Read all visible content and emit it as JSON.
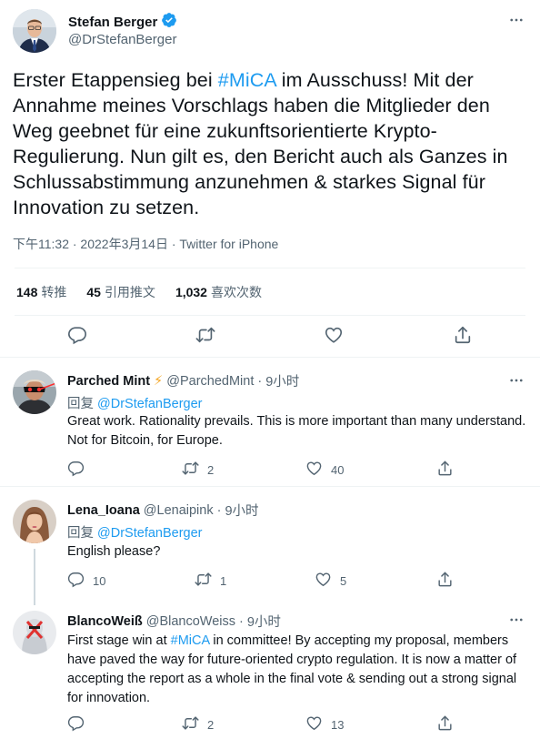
{
  "main_tweet": {
    "author_name": "Stefan Berger",
    "author_handle": "@DrStefanBerger",
    "text_before": "Erster Etappensieg bei ",
    "hashtag": "#MiCA",
    "text_after": " im Ausschuss! Mit der Annahme meines Vorschlags haben die Mitglieder den Weg geebnet für eine zukunftsorientierte Krypto-Regulierung. Nun gilt es, den Bericht auch als Ganzes in Schlussabstimmung anzunehmen & starkes Signal für Innovation zu setzen.",
    "timestamp": "下午11:32 · 2022年3月14日 · Twitter for iPhone",
    "retweets": "148",
    "retweets_label": "转推",
    "quotes": "45",
    "quotes_label": "引用推文",
    "likes": "1,032",
    "likes_label": "喜欢次数",
    "verified_color": "#1d9bf0"
  },
  "replies": [
    {
      "name": "Parched Mint",
      "badge": "⚡",
      "handle": "@ParchedMint",
      "time": "9小时",
      "reply_prefix": "回复",
      "reply_to": "@DrStefanBerger",
      "text": "Great work. Rationality prevails. This is more important than many understand. Not for Bitcoin, for Europe.",
      "retweets": "2",
      "likes": "40"
    },
    {
      "name": "Lena_Ioana",
      "handle": "@Lenaipink",
      "time": "9小时",
      "reply_prefix": "回复",
      "reply_to": "@DrStefanBerger",
      "text": "English please?",
      "replies": "10",
      "retweets": "1",
      "likes": "5"
    },
    {
      "name": "BlancoWeiß",
      "handle": "@BlancoWeiss",
      "time": "9小时",
      "text_before": "First stage win at ",
      "hashtag": "#MiCA",
      "text_after": " in committee! By accepting my proposal, members have paved the way for future-oriented crypto regulation. It is now a matter of accepting the report as a whole in the final vote & sending out a strong signal for innovation.",
      "retweets": "2",
      "likes": "13"
    }
  ],
  "separator": "·",
  "icons": [
    "verified-badge-icon",
    "more-icon",
    "reply-icon",
    "retweet-icon",
    "like-icon",
    "share-icon"
  ]
}
